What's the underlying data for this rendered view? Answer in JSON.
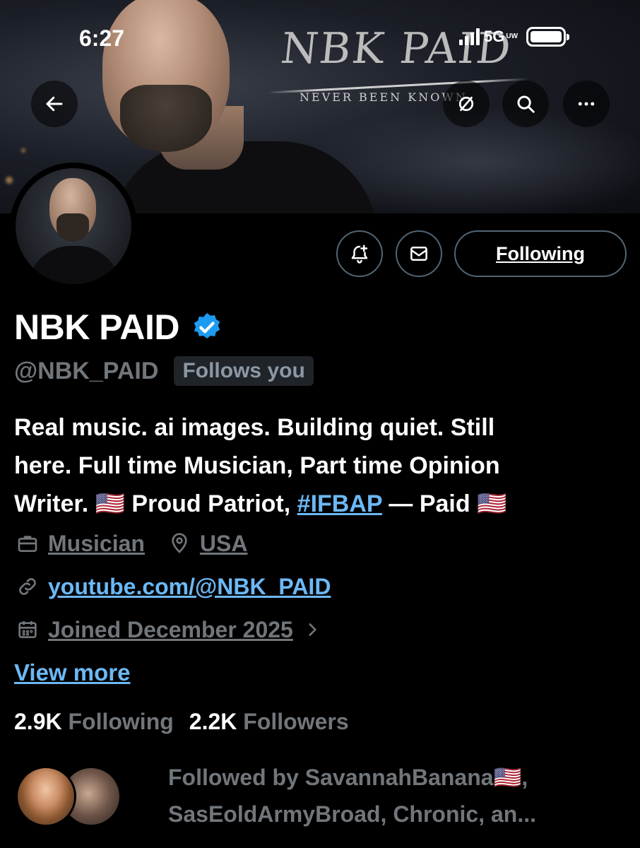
{
  "status_bar": {
    "time": "6:27",
    "network": "5G",
    "network_sub": "UW"
  },
  "banner": {
    "logo_text": "NBK PAID",
    "logo_subtitle": "NEVER BEEN KNOWN"
  },
  "nav": {
    "back_icon": "arrow-left-icon",
    "translate_icon": "hide-icon",
    "search_icon": "search-icon",
    "more_icon": "more-icon"
  },
  "actions": {
    "notify_icon": "bell-plus-icon",
    "message_icon": "mail-icon",
    "following_label": "Following"
  },
  "profile": {
    "name": "NBK PAID",
    "verified": true,
    "handle": "@NBK_PAID",
    "follows_you": "Follows you",
    "bio_line1": "Real music. ai images. Building quiet. Still",
    "bio_line2": "here. Full time Musician, Part time Opinion",
    "bio_line3_a": "Writer. 🇺🇸 Proud Patriot, ",
    "bio_hashtag": "#IFBAP",
    "bio_line3_b": " — Paid 🇺🇸",
    "category": "Musician",
    "location": "USA",
    "website": "youtube.com/@NBK_PAID",
    "joined": "Joined December 2025",
    "view_more": "View more"
  },
  "stats": {
    "following_count": "2.9K",
    "following_label": "Following",
    "followers_count": "2.2K",
    "followers_label": "Followers"
  },
  "followed_by": {
    "line1": "Followed by SavannahBanana🇺🇸,",
    "line2": "SasEoldArmyBroad, Chronic, an..."
  },
  "colors": {
    "background": "#000000",
    "link": "#6cb8f5",
    "muted": "#71767b",
    "verified": "#1d9bf0"
  }
}
